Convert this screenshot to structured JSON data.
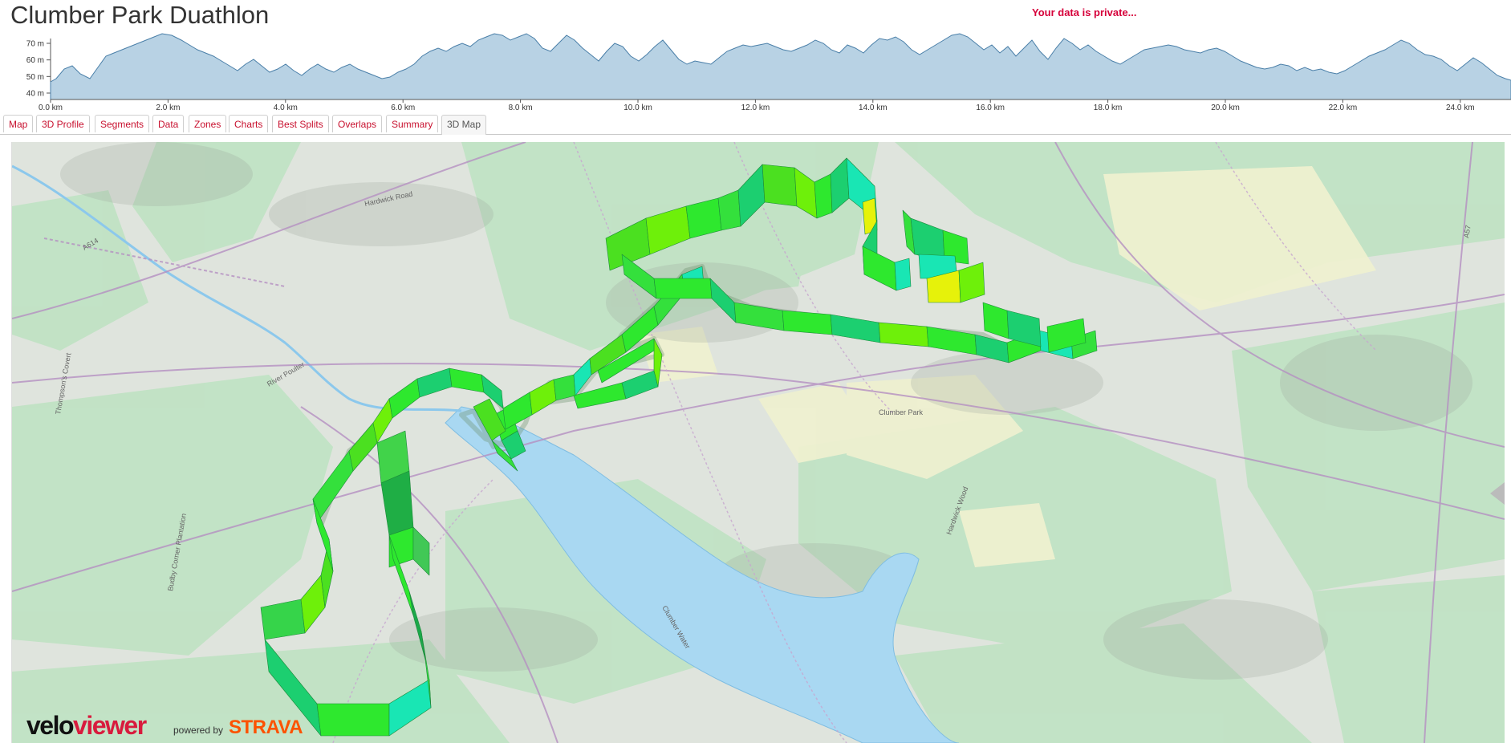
{
  "header": {
    "title": "Clumber Park Duathlon",
    "privacy_notice": "Your data is private..."
  },
  "elevation_profile": {
    "y_ticks": [
      "70 m",
      "60 m",
      "50 m",
      "40 m"
    ],
    "y_values": [
      70,
      60,
      50,
      40
    ],
    "x_ticks": [
      "0.0 km",
      "2.0 km",
      "4.0 km",
      "6.0 km",
      "8.0 km",
      "10.0 km",
      "12.0 km",
      "14.0 km",
      "16.0 km",
      "18.0 km",
      "20.0 km",
      "22.0 km",
      "24.0 km"
    ],
    "fill_color": "#b8d2e4",
    "line_color": "#4a7fa8"
  },
  "tabs": [
    {
      "label": "Map",
      "active": false
    },
    {
      "label": "3D Profile",
      "active": false
    },
    {
      "label": "Segments",
      "active": false
    },
    {
      "label": "Data",
      "active": false
    },
    {
      "label": "Zones",
      "active": false
    },
    {
      "label": "Charts",
      "active": false
    },
    {
      "label": "Best Splits",
      "active": false
    },
    {
      "label": "Overlaps",
      "active": false
    },
    {
      "label": "Summary",
      "active": false
    },
    {
      "label": "3D Map",
      "active": true
    }
  ],
  "map": {
    "labels": [
      "River Poulter",
      "Clumber Water",
      "Clumber Park",
      "Budby Corner Plantation",
      "Thompson's Covert",
      "Hardwick Wood",
      "A57",
      "A614",
      "Hardwick Road"
    ],
    "route_colors": [
      "#2ee82e",
      "#6ef00a",
      "#1ccf70",
      "#e6f20a",
      "#19e6b4"
    ]
  },
  "footer": {
    "logo_part1": "velo",
    "logo_part2": "viewer",
    "powered_by": "powered by",
    "strava": "STRAVA"
  },
  "accent_color": "#c8102e"
}
